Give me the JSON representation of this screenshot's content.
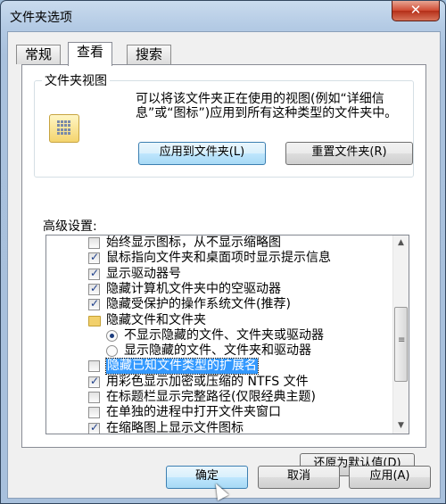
{
  "window": {
    "title": "文件夹选项",
    "close_glyph": "✕"
  },
  "tabs": [
    {
      "label": "常规"
    },
    {
      "label": "查看"
    },
    {
      "label": "搜索"
    }
  ],
  "folder_views": {
    "group_title": "文件夹视图",
    "description": "可以将该文件夹正在使用的视图(例如“详细信息”或“图标”)应用到所有这种类型的文件夹中。",
    "apply_button": "应用到文件夹(L)",
    "reset_button": "重置文件夹(R)"
  },
  "advanced": {
    "label": "高级设置:",
    "items": [
      {
        "kind": "checkbox",
        "checked": false,
        "indent": 1,
        "label": "始终显示图标，从不显示缩略图"
      },
      {
        "kind": "checkbox",
        "checked": true,
        "indent": 1,
        "label": "鼠标指向文件夹和桌面项时显示提示信息"
      },
      {
        "kind": "checkbox",
        "checked": true,
        "indent": 1,
        "label": "显示驱动器号"
      },
      {
        "kind": "checkbox",
        "checked": true,
        "indent": 1,
        "label": "隐藏计算机文件夹中的空驱动器"
      },
      {
        "kind": "checkbox",
        "checked": true,
        "indent": 1,
        "label": "隐藏受保护的操作系统文件(推荐)"
      },
      {
        "kind": "folder",
        "checked": false,
        "indent": 1,
        "label": "隐藏文件和文件夹"
      },
      {
        "kind": "radio",
        "checked": true,
        "indent": 2,
        "label": "不显示隐藏的文件、文件夹或驱动器"
      },
      {
        "kind": "radio",
        "checked": false,
        "indent": 2,
        "label": "显示隐藏的文件、文件夹和驱动器"
      },
      {
        "kind": "checkbox",
        "checked": false,
        "indent": 1,
        "label": "隐藏已知文件类型的扩展名",
        "selected": true
      },
      {
        "kind": "checkbox",
        "checked": true,
        "indent": 1,
        "label": "用彩色显示加密或压缩的 NTFS 文件"
      },
      {
        "kind": "checkbox",
        "checked": false,
        "indent": 1,
        "label": "在标题栏显示完整路径(仅限经典主题)"
      },
      {
        "kind": "checkbox",
        "checked": false,
        "indent": 1,
        "label": "在单独的进程中打开文件夹窗口"
      },
      {
        "kind": "checkbox",
        "checked": true,
        "indent": 1,
        "label": "在缩略图上显示文件图标"
      }
    ],
    "restore_button": "还原为默认值(D)"
  },
  "footer": {
    "ok_button": "确定",
    "cancel_button": "取消",
    "apply_button": "应用(A)"
  }
}
